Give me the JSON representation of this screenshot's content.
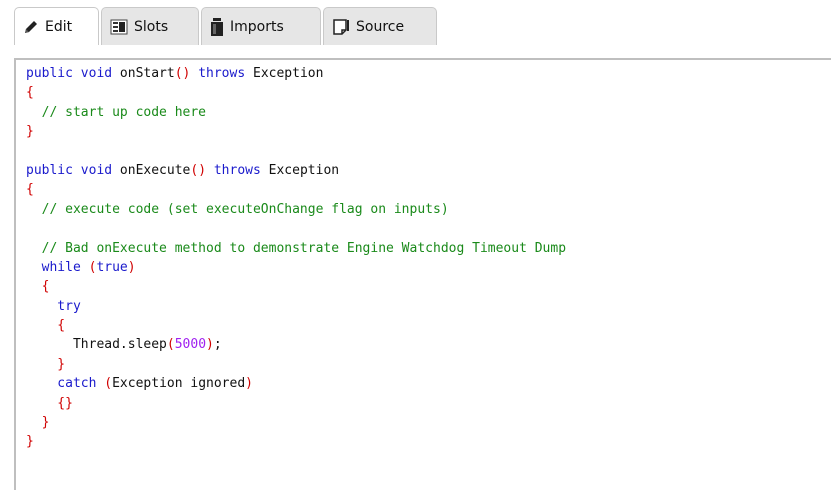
{
  "tabs": [
    {
      "label": "Edit",
      "icon": "pencil-icon",
      "active": true
    },
    {
      "label": "Slots",
      "icon": "slots-icon",
      "active": false
    },
    {
      "label": "Imports",
      "icon": "imports-icon",
      "active": false
    },
    {
      "label": "Source",
      "icon": "source-icon",
      "active": false
    }
  ],
  "colors": {
    "keyword": "#1a1acc",
    "punctuation": "#d00000",
    "comment": "#1a8a1a",
    "number": "#a020f0",
    "text": "#111111"
  },
  "code": {
    "lines": [
      [
        {
          "t": "kw",
          "v": "public void"
        },
        {
          "t": "tx",
          "v": " onStart"
        },
        {
          "t": "pn",
          "v": "()"
        },
        {
          "t": "kw",
          "v": " throws"
        },
        {
          "t": "tx",
          "v": " Exception"
        }
      ],
      [
        {
          "t": "pn",
          "v": "{"
        }
      ],
      [
        {
          "t": "cm",
          "v": "  // start up code here"
        }
      ],
      [
        {
          "t": "pn",
          "v": "}"
        }
      ],
      [],
      [
        {
          "t": "kw",
          "v": "public void"
        },
        {
          "t": "tx",
          "v": " onExecute"
        },
        {
          "t": "pn",
          "v": "()"
        },
        {
          "t": "kw",
          "v": " throws"
        },
        {
          "t": "tx",
          "v": " Exception"
        }
      ],
      [
        {
          "t": "pn",
          "v": "{"
        }
      ],
      [
        {
          "t": "cm",
          "v": "  // execute code (set executeOnChange flag on inputs)"
        }
      ],
      [],
      [
        {
          "t": "cm",
          "v": "  // Bad onExecute method to demonstrate Engine Watchdog Timeout Dump"
        }
      ],
      [
        {
          "t": "kw",
          "v": "  while"
        },
        {
          "t": "tx",
          "v": " "
        },
        {
          "t": "pn",
          "v": "("
        },
        {
          "t": "kw",
          "v": "true"
        },
        {
          "t": "pn",
          "v": ")"
        }
      ],
      [
        {
          "t": "pn",
          "v": "  {"
        }
      ],
      [
        {
          "t": "kw",
          "v": "    try"
        }
      ],
      [
        {
          "t": "pn",
          "v": "    {"
        }
      ],
      [
        {
          "t": "tx",
          "v": "      Thread.sleep"
        },
        {
          "t": "pn",
          "v": "("
        },
        {
          "t": "nm",
          "v": "5000"
        },
        {
          "t": "pn",
          "v": ")"
        },
        {
          "t": "tx",
          "v": ";"
        }
      ],
      [
        {
          "t": "pn",
          "v": "    }"
        }
      ],
      [
        {
          "t": "kw",
          "v": "    catch"
        },
        {
          "t": "tx",
          "v": " "
        },
        {
          "t": "pn",
          "v": "("
        },
        {
          "t": "tx",
          "v": "Exception ignored"
        },
        {
          "t": "pn",
          "v": ")"
        }
      ],
      [
        {
          "t": "pn",
          "v": "    {}"
        }
      ],
      [
        {
          "t": "pn",
          "v": "  }"
        }
      ],
      [
        {
          "t": "pn",
          "v": "}"
        }
      ]
    ]
  }
}
